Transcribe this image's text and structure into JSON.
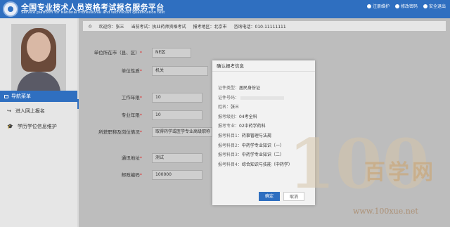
{
  "header": {
    "title_cn": "全国专业技术人员资格考试报名服务平台",
    "title_en": "Service platform for National Professional and technician qualification test",
    "links": [
      "注册维护",
      "修改密码",
      "安全退出"
    ]
  },
  "sidebar": {
    "nav_title": "导航菜单",
    "items": [
      {
        "icon": "↪",
        "label": "进入网上报名"
      },
      {
        "icon": "🎓",
        "label": "学历学位信息维护"
      }
    ]
  },
  "infobar": {
    "welcome": "欢迎你：张三",
    "current_exam": "当前考试：执业药师资格考试",
    "exam_area": "报考地区：北京市",
    "phone": "咨询电话：010-11111111"
  },
  "form": {
    "rows": [
      {
        "label": "单位所在市（县、区）",
        "value": "NE区"
      },
      {
        "label": "单位性质",
        "value": "机关"
      },
      {
        "label": "工作年限",
        "value": "10"
      },
      {
        "label": "专业年限",
        "value": "10"
      },
      {
        "label": "所获职称及岗位情况",
        "value": "取得药学或医学专业高级职称"
      },
      {
        "label": "通讯地址",
        "value": "测试"
      },
      {
        "label": "邮政编码",
        "value": "100000"
      }
    ]
  },
  "modal": {
    "title": "确认报考信息",
    "lines": [
      {
        "k": "证件类型：",
        "v": "居民身份证"
      },
      {
        "k": "证件号码：",
        "v": ""
      },
      {
        "k": "姓名：",
        "v": "张三"
      },
      {
        "k": "报考级别：",
        "v": "04考全科"
      },
      {
        "k": "报考专业：",
        "v": "02中药学药科"
      },
      {
        "k": "报考科目1：",
        "v": "药事管理与法规"
      },
      {
        "k": "报考科目2：",
        "v": "中药学专业知识（一）"
      },
      {
        "k": "报考科目3：",
        "v": "中药学专业知识（二）"
      },
      {
        "k": "报考科目4：",
        "v": "综合知识与技能（中药学）"
      }
    ],
    "ok": "确定",
    "cancel": "取消"
  },
  "watermark": {
    "num": "100",
    "cn": "百学网",
    "url": "www.100xue.net"
  },
  "colors": {
    "primary": "#2f6fc0",
    "required": "#dd3333"
  }
}
